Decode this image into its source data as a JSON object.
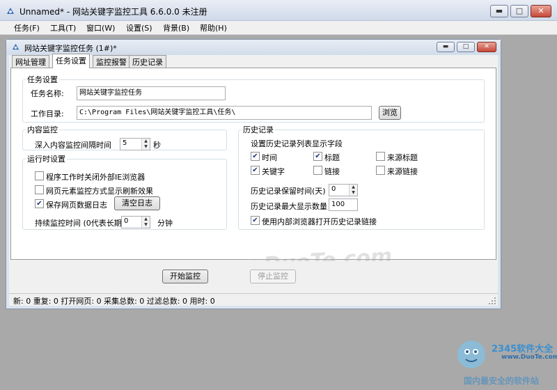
{
  "app": {
    "title": "Unnamed* - 网站关键字监控工具 6.6.0.0  未注册",
    "window_buttons": {
      "minimize": "▬",
      "maximize": "□",
      "close": "✕"
    }
  },
  "menu": {
    "items": [
      "任务(F)",
      "工具(T)",
      "窗口(W)",
      "设置(S)",
      "背景(B)",
      "帮助(H)"
    ]
  },
  "child": {
    "title": "网站关键字监控任务  (1#)*",
    "tabs": [
      "网址管理",
      "任务设置",
      "监控报警",
      "历史记录"
    ],
    "active_tab": "任务设置"
  },
  "task_settings": {
    "legend": "任务设置",
    "name_label": "任务名称:",
    "name_value": "网站关键字监控任务",
    "dir_label": "工作目录:",
    "dir_value": "C:\\Program Files\\网站关键字监控工具\\任务\\",
    "browse_label": "浏览"
  },
  "content_monitor": {
    "legend": "内容监控",
    "interval_label": "深入内容监控间隔时间",
    "interval_value": "5",
    "interval_unit": "秒"
  },
  "runtime": {
    "legend": "运行时设置",
    "opt1_label": "程序工作时关闭外部IE浏览器",
    "opt1_checked": false,
    "opt2_label": "网页元素监控方式显示刷新效果",
    "opt2_checked": false,
    "opt3_label": "保存网页数据日志",
    "opt3_checked": true,
    "clear_log_label": "清空日志",
    "duration_label": "持续监控时间 (0代表长期)",
    "duration_value": "0",
    "duration_unit": "分钟"
  },
  "history": {
    "legend": "历史记录",
    "fields_label": "设置历史记录列表显示字段",
    "fields": [
      {
        "label": "时间",
        "checked": true
      },
      {
        "label": "标题",
        "checked": true
      },
      {
        "label": "来源标题",
        "checked": false
      },
      {
        "label": "关键字",
        "checked": true
      },
      {
        "label": "链接",
        "checked": false
      },
      {
        "label": "来源链接",
        "checked": false
      }
    ],
    "keep_days_label": "历史记录保留时间(天)",
    "keep_days_value": "0",
    "max_count_label": "历史记录最大显示数量",
    "max_count_value": "100",
    "internal_browser_label": "使用内部浏览器打开历史记录链接",
    "internal_browser_checked": true
  },
  "actions": {
    "start_label": "开始监控",
    "stop_label": "停止监控"
  },
  "status": {
    "text": "新: 0  重复: 0  打开网页: 0  采集总数: 0  过滤总数: 0  用时: 0"
  },
  "watermark": {
    "text": "www.DuoTe.com"
  },
  "corner_logo": {
    "brand": "2345软件大全",
    "url": "www.DuoTe.com",
    "slogan": "国内最安全的软件站"
  },
  "colors": {
    "title_gradient_top": "#e9eef6",
    "title_gradient_bottom": "#cfd9e8",
    "mdi_background": "#a9a9a9",
    "check_mark": "#21327a"
  },
  "icons": {
    "app": "app-satellite-icon",
    "child": "child-satellite-icon"
  }
}
